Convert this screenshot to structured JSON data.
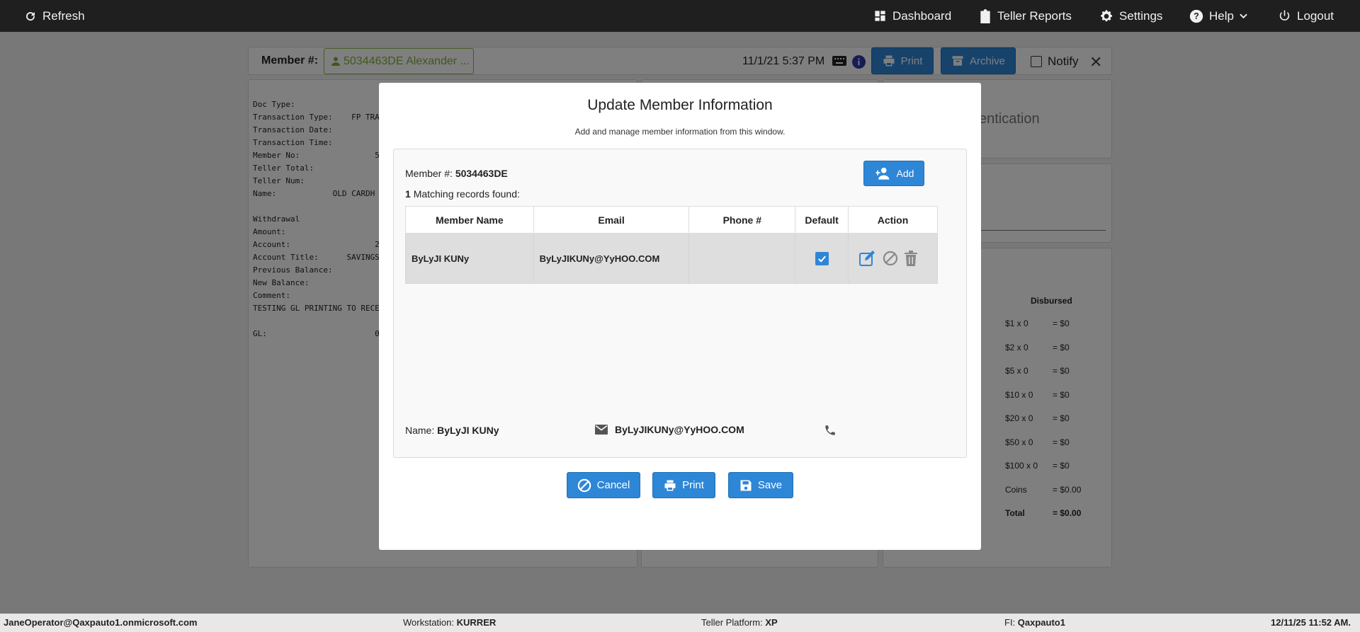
{
  "topbar": {
    "refresh": "Refresh",
    "dashboard": "Dashboard",
    "teller_reports": "Teller Reports",
    "settings": "Settings",
    "help": "Help",
    "logout": "Logout"
  },
  "memberbar": {
    "label": "Member #:",
    "member_chip": "5034463DE Alexander ...",
    "datetime": "11/1/21 5:37 PM",
    "print": "Print",
    "archive": "Archive",
    "notify": "Notify"
  },
  "receipt_text": "Doc Type:\nTransaction Type:    FP TRA\nTransaction Date:\nTransaction Time:\nMember No:                5\nTeller Total:\nTeller Num:\nName:            OLD CARDH\n\nWithdrawal\nAmount:\nAccount:                  2\nAccount Title:      SAVINGS\nPrevious Balance:\nNew Balance:\nComment:\nTESTING GL PRINTING TO RECE\n\nGL:                       0",
  "right_panel": {
    "auth_text": "entication",
    "disbursed_header": "Disbursed",
    "rows": [
      {
        "denom": "$1 x 0",
        "amount": "= $0"
      },
      {
        "denom": "$2 x 0",
        "amount": "= $0"
      },
      {
        "denom": "$5 x 0",
        "amount": "= $0"
      },
      {
        "denom": "$10 x 0",
        "amount": "= $0"
      },
      {
        "denom": "$20 x 0",
        "amount": "= $0"
      },
      {
        "denom": "$50 x 0",
        "amount": "= $0"
      },
      {
        "denom": "$100 x 0",
        "amount": "= $0"
      },
      {
        "denom": "Coins",
        "amount": "= $0.00"
      },
      {
        "denom": "Total",
        "amount": "= $0.00"
      }
    ]
  },
  "modal": {
    "title": "Update Member Information",
    "subtitle": "Add and manage member information from this window.",
    "member_label": "Member #:",
    "member_number": "5034463DE",
    "match_count": "1",
    "match_text": "Matching records found:",
    "add_button": "Add",
    "columns": [
      "Member Name",
      "Email",
      "Phone #",
      "Default",
      "Action"
    ],
    "rows": [
      {
        "name": "ByLyJI KUNy",
        "email": "ByLyJIKUNy@YyHOO.COM",
        "phone": "",
        "default": true
      }
    ],
    "detail_name_label": "Name:",
    "detail_name": "ByLyJI KUNy",
    "detail_email": "ByLyJIKUNy@YyHOO.COM",
    "cancel": "Cancel",
    "print": "Print",
    "save": "Save"
  },
  "statusbar": {
    "user": "JaneOperator@Qaxpauto1.onmicrosoft.com",
    "workstation_label": "Workstation:",
    "workstation": "KURRER",
    "platform_label": "Teller Platform:",
    "platform": "XP",
    "fi_label": "FI:",
    "fi": "Qaxpauto1",
    "datetime": "12/11/25 11:52 AM."
  }
}
